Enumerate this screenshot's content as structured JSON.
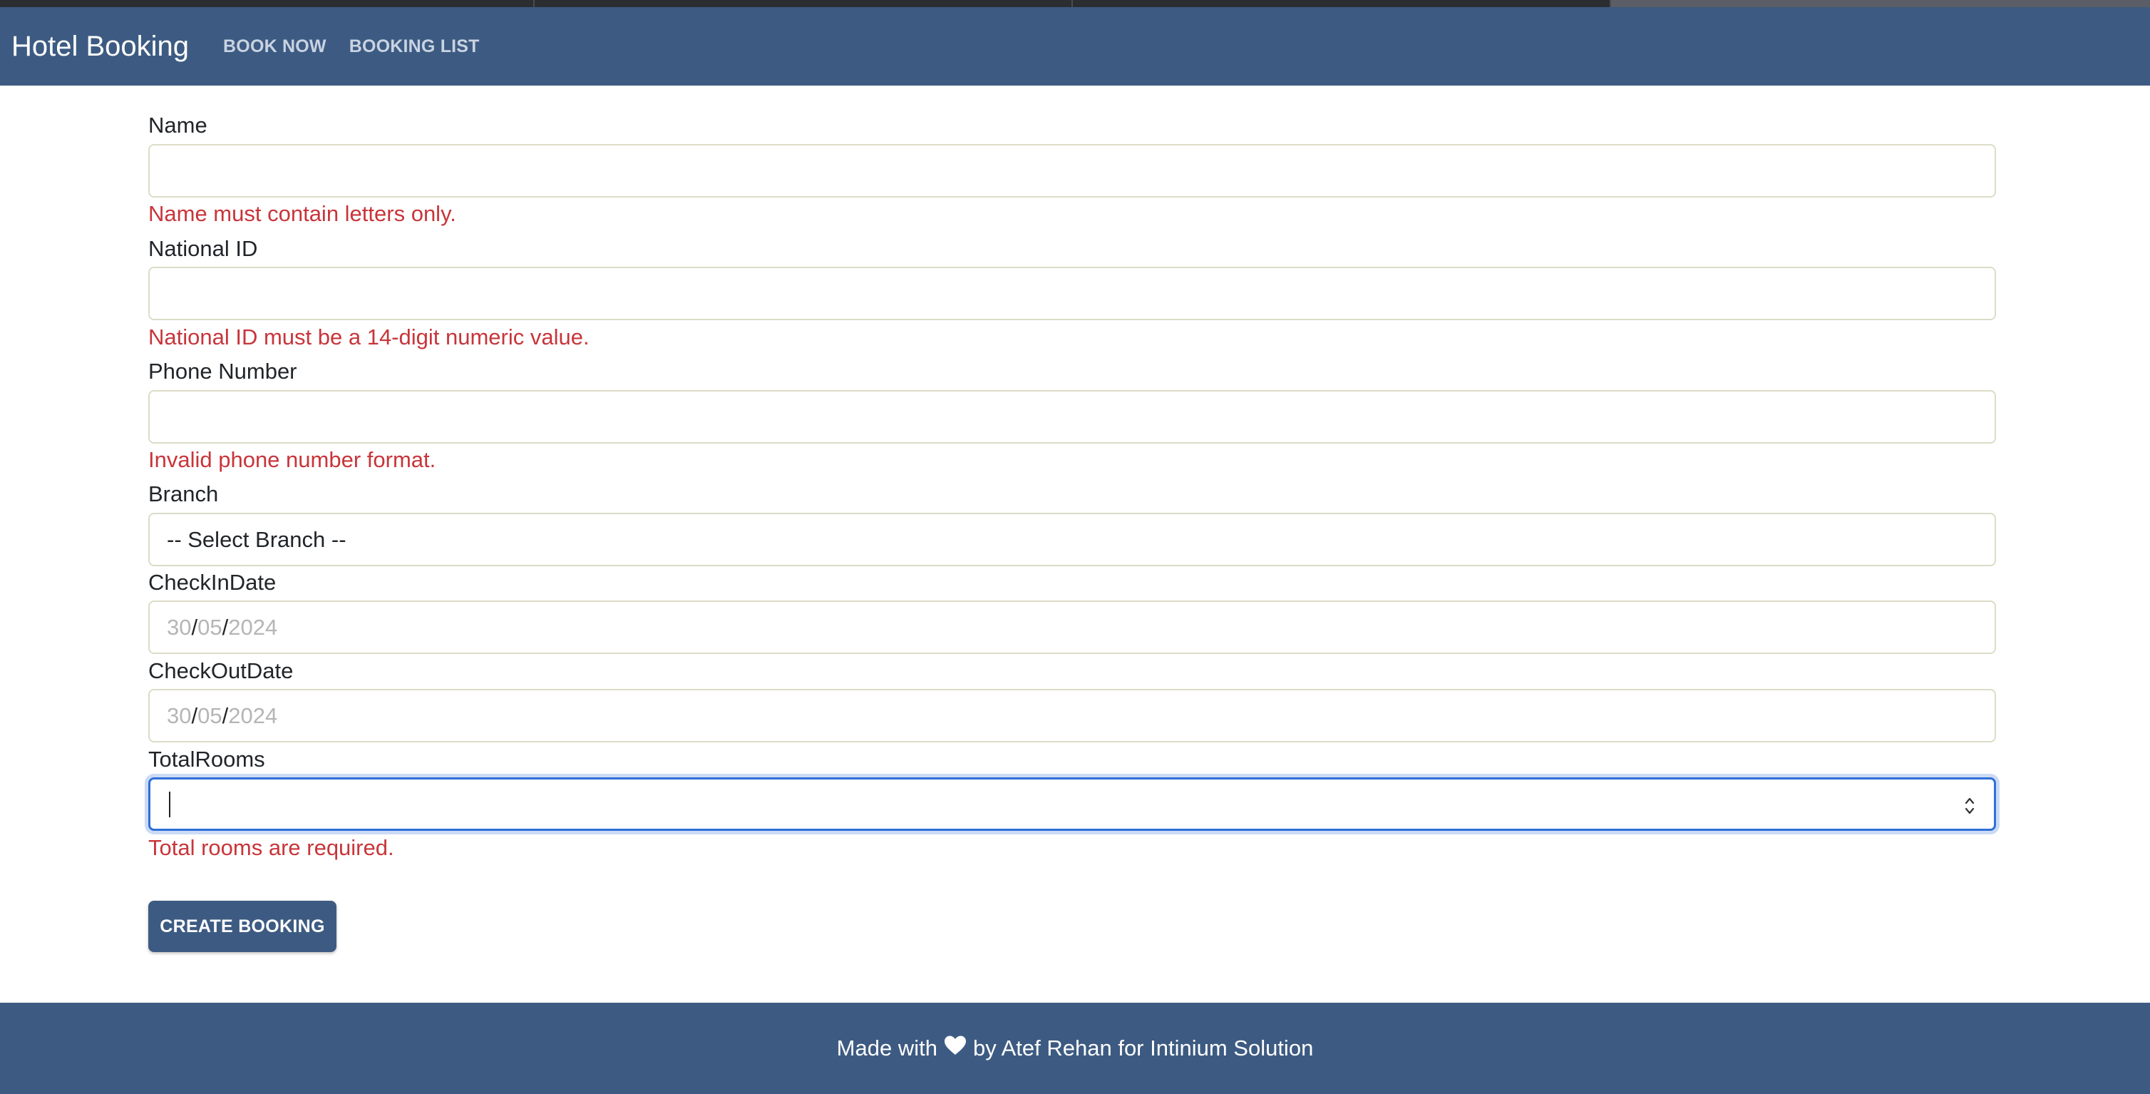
{
  "nav": {
    "brand": "Hotel Booking",
    "links": [
      "BOOK NOW",
      "BOOKING LIST"
    ]
  },
  "form": {
    "name": {
      "label": "Name",
      "value": "",
      "error": "Name must contain letters only."
    },
    "national_id": {
      "label": "National ID",
      "value": "",
      "error": "National ID must be a 14-digit numeric value."
    },
    "phone": {
      "label": "Phone Number",
      "value": "",
      "error": "Invalid phone number format."
    },
    "branch": {
      "label": "Branch",
      "selected": "-- Select Branch --"
    },
    "checkin": {
      "label": "CheckInDate",
      "day": "30",
      "month": "05",
      "year": "2024"
    },
    "checkout": {
      "label": "CheckOutDate",
      "day": "30",
      "month": "05",
      "year": "2024"
    },
    "total_rooms": {
      "label": "TotalRooms",
      "value": "",
      "error": "Total rooms are required."
    },
    "submit_label": "CREATE BOOKING"
  },
  "footer": {
    "prefix": "Made with",
    "suffix": "by Atef Rehan for Intinium Solution"
  },
  "colors": {
    "primary": "#3d5b82",
    "error": "#c8353a",
    "focus": "#2f6fd8"
  },
  "icons": {
    "footer_heart": "heart-icon",
    "spinner": "spinner-arrows-icon"
  }
}
